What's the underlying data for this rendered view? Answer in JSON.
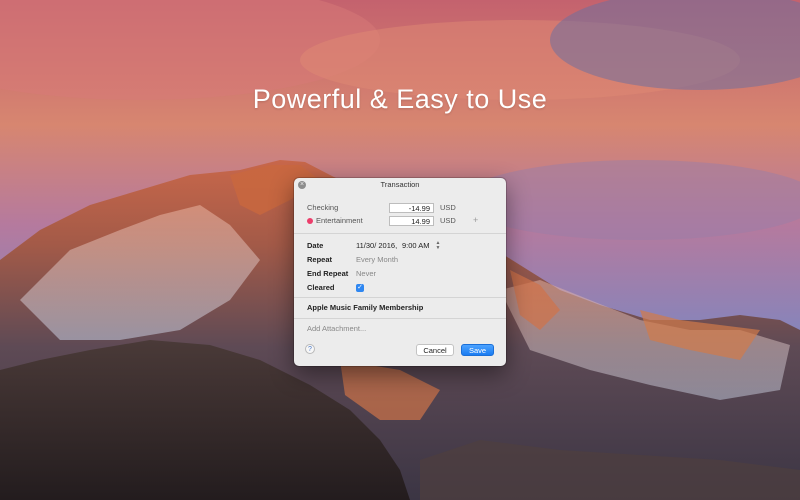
{
  "headline": "Powerful & Easy to Use",
  "dialog": {
    "title": "Transaction",
    "account_label": "Checking",
    "account_amount": "-14.99",
    "account_currency": "USD",
    "category_label": "Entertainment",
    "category_color": "#ec3e6b",
    "category_amount": "14.99",
    "category_currency": "USD",
    "add_split": "+",
    "date_label": "Date",
    "date_value": "11/30/ 2016,",
    "time_value": "9:00 AM",
    "repeat_label": "Repeat",
    "repeat_value": "Every Month",
    "end_repeat_label": "End Repeat",
    "end_repeat_value": "Never",
    "cleared_label": "Cleared",
    "cleared_checked": true,
    "payee": "Apple Music Family Membership",
    "attachment_placeholder": "Add Attachment...",
    "help": "?",
    "cancel": "Cancel",
    "save": "Save"
  },
  "colors": {
    "accent": "#1a7cf2"
  }
}
